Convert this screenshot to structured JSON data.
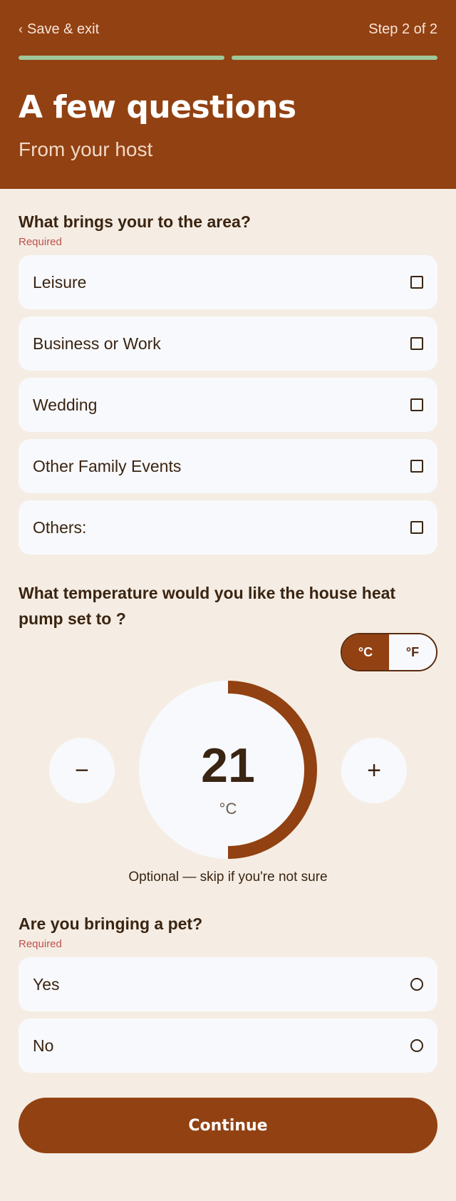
{
  "header": {
    "save_exit": "Save & exit",
    "step": "Step 2 of 2",
    "title": "A few questions",
    "subtitle": "From your host",
    "progress_completed_steps": 2,
    "progress_total_steps": 2
  },
  "q1": {
    "title": "What brings your to the area?",
    "required": "Required",
    "options": [
      "Leisure",
      "Business or Work",
      "Wedding",
      "Other Family Events",
      "Others:"
    ]
  },
  "q2": {
    "title": "What temperature would you like the house heat pump set to ?",
    "unit_c": "°C",
    "unit_f": "°F",
    "selected_unit": "°C",
    "minus": "−",
    "plus": "+",
    "value": "21",
    "unit_label": "°C",
    "dial_fill_fraction": 0.5,
    "note": "Optional — skip if you're not sure"
  },
  "q3": {
    "title": "Are you bringing a pet?",
    "required": "Required",
    "options": [
      "Yes",
      "No"
    ]
  },
  "continue_label": "Continue",
  "colors": {
    "brand": "#924112",
    "background": "#f5ede3",
    "card": "#f8f9fc",
    "progress": "#9fc79a",
    "required": "#c0504d"
  }
}
